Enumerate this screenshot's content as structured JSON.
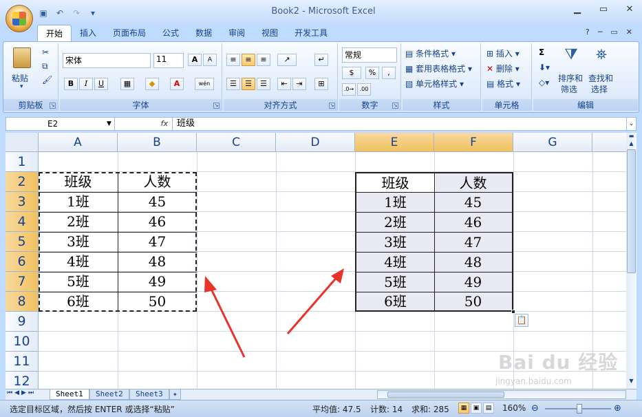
{
  "window": {
    "title": "Book2 - Microsoft Excel"
  },
  "tabs": [
    "开始",
    "插入",
    "页面布局",
    "公式",
    "数据",
    "审阅",
    "视图",
    "开发工具"
  ],
  "ribbon": {
    "clipboard": {
      "paste": "粘贴",
      "label": "剪贴板"
    },
    "font": {
      "name": "宋体",
      "size": "11",
      "label": "字体",
      "bold": "B",
      "italic": "I",
      "underline": "U",
      "grow": "A",
      "shrink": "A",
      "wen": "wén"
    },
    "alignment": {
      "label": "对齐方式"
    },
    "number": {
      "format": "常规",
      "percent": "%",
      "comma": ",",
      "label": "数字"
    },
    "styles": {
      "conditional": "条件格式",
      "table": "套用表格格式",
      "cell": "单元格样式",
      "label": "样式"
    },
    "cells": {
      "insert": "插入",
      "delete": "删除",
      "format": "格式",
      "label": "单元格"
    },
    "editing": {
      "sort": "排序和",
      "sort2": "筛选",
      "find": "查找和",
      "find2": "选择",
      "sigma": "Σ",
      "label": "编辑"
    }
  },
  "formula_bar": {
    "name_box": "E2",
    "fx": "fx",
    "value": "班级"
  },
  "columns": [
    "A",
    "B",
    "C",
    "D",
    "E",
    "F",
    "G"
  ],
  "rows": [
    "1",
    "2",
    "3",
    "4",
    "5",
    "6",
    "7",
    "8",
    "9",
    "10",
    "11",
    "12"
  ],
  "source_table": {
    "header": [
      "班级",
      "人数"
    ],
    "rows": [
      [
        "1班",
        "45"
      ],
      [
        "2班",
        "46"
      ],
      [
        "3班",
        "47"
      ],
      [
        "4班",
        "48"
      ],
      [
        "5班",
        "49"
      ],
      [
        "6班",
        "50"
      ]
    ]
  },
  "pasted_table": {
    "header": [
      "班级",
      "人数"
    ],
    "rows": [
      [
        "1班",
        "45"
      ],
      [
        "2班",
        "46"
      ],
      [
        "3班",
        "47"
      ],
      [
        "4班",
        "48"
      ],
      [
        "5班",
        "49"
      ],
      [
        "6班",
        "50"
      ]
    ]
  },
  "sheets": [
    "Sheet1",
    "Sheet2",
    "Sheet3"
  ],
  "status": {
    "message": "选定目标区域，然后按 ENTER 或选择“粘贴”",
    "average": "平均值: 47.5",
    "count": "计数: 14",
    "sum": "求和: 285",
    "zoom": "160%"
  },
  "watermark": {
    "brand": "Bai du 经验",
    "url": "jingyan.baidu.com"
  },
  "colors": {
    "accent": "#f1c15f",
    "arrow": "#e8322a",
    "ribbon": "#bfdbff"
  }
}
